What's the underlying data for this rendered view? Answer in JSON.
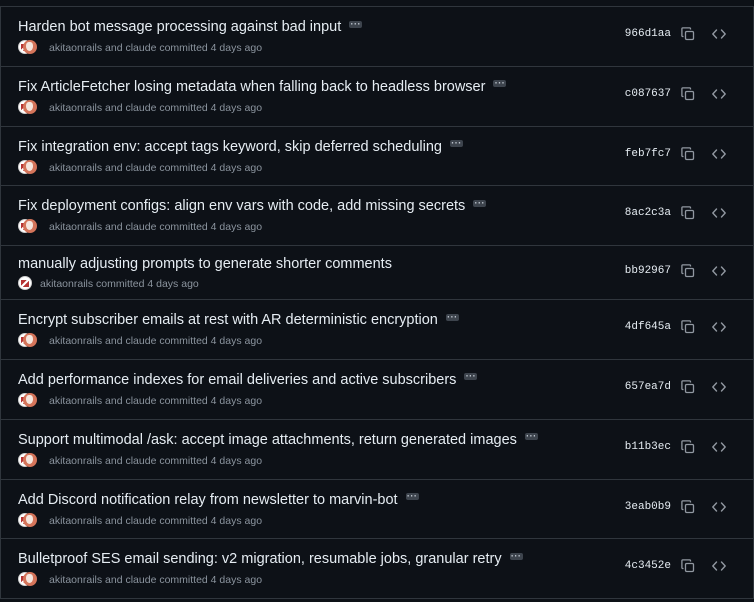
{
  "colors": {
    "background": "#0d1117",
    "border": "#30363d",
    "title_text": "#e6edf3",
    "meta_text": "#8b949e"
  },
  "commits": [
    {
      "title": "Harden bot message processing against bad input",
      "meta": "akitaonrails and claude committed 4 days ago",
      "sha": "966d1aa",
      "has_ellipsis": true,
      "coauthored": true
    },
    {
      "title": "Fix ArticleFetcher losing metadata when falling back to headless browser",
      "meta": "akitaonrails and claude committed 4 days ago",
      "sha": "c087637",
      "has_ellipsis": true,
      "coauthored": true
    },
    {
      "title": "Fix integration env: accept tags keyword, skip deferred scheduling",
      "meta": "akitaonrails and claude committed 4 days ago",
      "sha": "feb7fc7",
      "has_ellipsis": true,
      "coauthored": true
    },
    {
      "title": "Fix deployment configs: align env vars with code, add missing secrets",
      "meta": "akitaonrails and claude committed 4 days ago",
      "sha": "8ac2c3a",
      "has_ellipsis": true,
      "coauthored": true
    },
    {
      "title": "manually adjusting prompts to generate shorter comments",
      "meta": "akitaonrails committed 4 days ago",
      "sha": "bb92967",
      "has_ellipsis": false,
      "coauthored": false
    },
    {
      "title": "Encrypt subscriber emails at rest with AR deterministic encryption",
      "meta": "akitaonrails and claude committed 4 days ago",
      "sha": "4df645a",
      "has_ellipsis": true,
      "coauthored": true
    },
    {
      "title": "Add performance indexes for email deliveries and active subscribers",
      "meta": "akitaonrails and claude committed 4 days ago",
      "sha": "657ea7d",
      "has_ellipsis": true,
      "coauthored": true
    },
    {
      "title": "Support multimodal /ask: accept image attachments, return generated images",
      "meta": "akitaonrails and claude committed 4 days ago",
      "sha": "b11b3ec",
      "has_ellipsis": true,
      "coauthored": true
    },
    {
      "title": "Add Discord notification relay from newsletter to marvin-bot",
      "meta": "akitaonrails and claude committed 4 days ago",
      "sha": "3eab0b9",
      "has_ellipsis": true,
      "coauthored": true
    },
    {
      "title": "Bulletproof SES email sending: v2 migration, resumable jobs, granular retry",
      "meta": "akitaonrails and claude committed 4 days ago",
      "sha": "4c3452e",
      "has_ellipsis": true,
      "coauthored": true
    }
  ],
  "icons": {
    "copy": "copy-icon",
    "browse": "code-icon",
    "ellipsis": "ellipsis-icon"
  }
}
